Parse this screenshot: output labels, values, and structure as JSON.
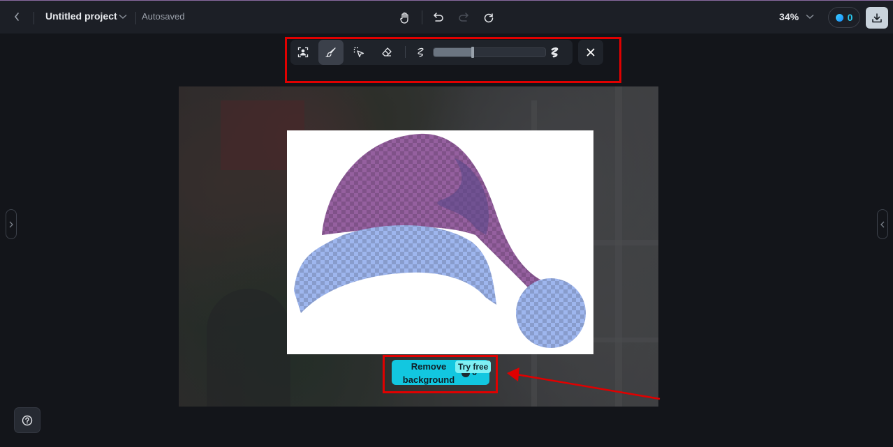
{
  "topbar": {
    "back_icon": "chevron-left-icon",
    "project_title": "Untitled project",
    "title_dropdown_icon": "chevron-down-icon",
    "save_status": "Autosaved",
    "center_tools": [
      {
        "name": "hand-tool",
        "icon": "hand-icon",
        "enabled": true
      },
      {
        "name": "undo",
        "icon": "undo-icon",
        "enabled": true
      },
      {
        "name": "redo",
        "icon": "redo-icon",
        "enabled": false
      },
      {
        "name": "refresh",
        "icon": "refresh-icon",
        "enabled": true
      }
    ],
    "zoom_level": "34%",
    "credits": "0",
    "download_icon": "download-icon"
  },
  "edit_toolbar": {
    "tools": [
      {
        "name": "auto-select-subject",
        "icon": "person-select-icon",
        "active": false
      },
      {
        "name": "brush",
        "icon": "brush-icon",
        "active": true
      },
      {
        "name": "lasso-select",
        "icon": "select-cursor-icon",
        "active": false
      },
      {
        "name": "eraser",
        "icon": "eraser-icon",
        "active": false
      }
    ],
    "brush_size_min_icon": "thin-stroke-icon",
    "brush_size_max_icon": "thick-stroke-icon",
    "brush_size_fraction": 0.35,
    "close_icon": "close-icon"
  },
  "canvas": {
    "image_description": "Santa hat with transparency checkerboard overlay",
    "remove_bg": {
      "label": "Remove background",
      "cost": "0",
      "badge": "Try free"
    }
  },
  "side_panels": {
    "left_toggle_icon": "chevron-right-icon",
    "right_toggle_icon": "chevron-left-icon"
  },
  "help": {
    "icon": "help-icon"
  },
  "colors": {
    "accent": "#12c7e0",
    "highlight_annotation": "#e00000",
    "topbar_bg": "#1c1f26",
    "page_bg": "#13151a"
  }
}
